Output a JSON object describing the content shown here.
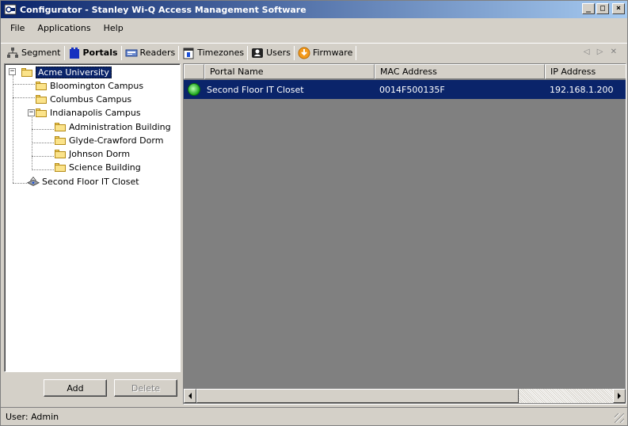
{
  "window": {
    "title": "Configurator - Stanley Wi-Q Access Management Software",
    "minimize_label": "_",
    "maximize_label": "□",
    "close_label": "×"
  },
  "menu": {
    "file": "File",
    "applications": "Applications",
    "help": "Help"
  },
  "toolbar": {
    "tabs": [
      {
        "label": "Segment",
        "icon": "segment-icon"
      },
      {
        "label": "Portals",
        "icon": "portals-icon",
        "active": true
      },
      {
        "label": "Readers",
        "icon": "readers-icon"
      },
      {
        "label": "Timezones",
        "icon": "timezones-icon"
      },
      {
        "label": "Users",
        "icon": "users-icon"
      },
      {
        "label": "Firmware",
        "icon": "firmware-icon"
      }
    ],
    "nav": "◁ ▷ ✕"
  },
  "tree": {
    "root": "Acme University",
    "bloomington": "Bloomington Campus",
    "columbus": "Columbus Campus",
    "indianapolis": "Indianapolis Campus",
    "admin_building": "Administration Building",
    "glyde": "Glyde-Crawford Dorm",
    "johnson": "Johnson Dorm",
    "science": "Science Building",
    "closet": "Second Floor IT Closet",
    "minus": "−"
  },
  "buttons": {
    "add": "Add",
    "delete": "Delete"
  },
  "grid": {
    "columns": [
      "Portal Name",
      "MAC Address",
      "IP Address"
    ],
    "rows": [
      {
        "portal_name": "Second Floor IT Closet",
        "mac": "0014F500135F",
        "ip": "192.168.1.200"
      }
    ]
  },
  "status": {
    "user": "User: Admin"
  },
  "colors": {
    "selection": "#0a246a",
    "titlebar_start": "#0a246a",
    "titlebar_end": "#a6caf0"
  }
}
